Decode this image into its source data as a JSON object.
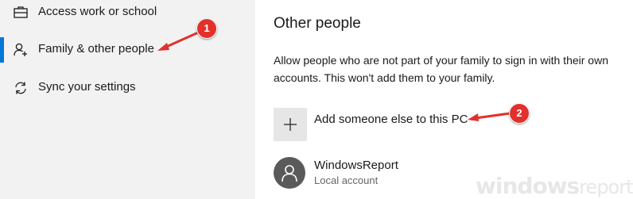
{
  "sidebar": {
    "items": [
      {
        "label": "Access work or school",
        "icon": "briefcase-icon",
        "active": false
      },
      {
        "label": "Family & other people",
        "icon": "person-add-icon",
        "active": true
      },
      {
        "label": "Sync your settings",
        "icon": "sync-icon",
        "active": false
      }
    ]
  },
  "main": {
    "title": "Other people",
    "description": "Allow people who are not part of your family to sign in with their own accounts. This won't add them to your family.",
    "add_label": "Add someone else to this PC",
    "account": {
      "name": "WindowsReport",
      "type": "Local account"
    }
  },
  "callouts": {
    "badge1": "1",
    "badge2": "2"
  },
  "watermark": {
    "brand": "windows",
    "suffix": "report"
  },
  "colors": {
    "accent": "#0078d7",
    "callout": "#e2312c",
    "sidebar_bg": "#f2f2f2",
    "avatar_bg": "#5a5a5a"
  }
}
